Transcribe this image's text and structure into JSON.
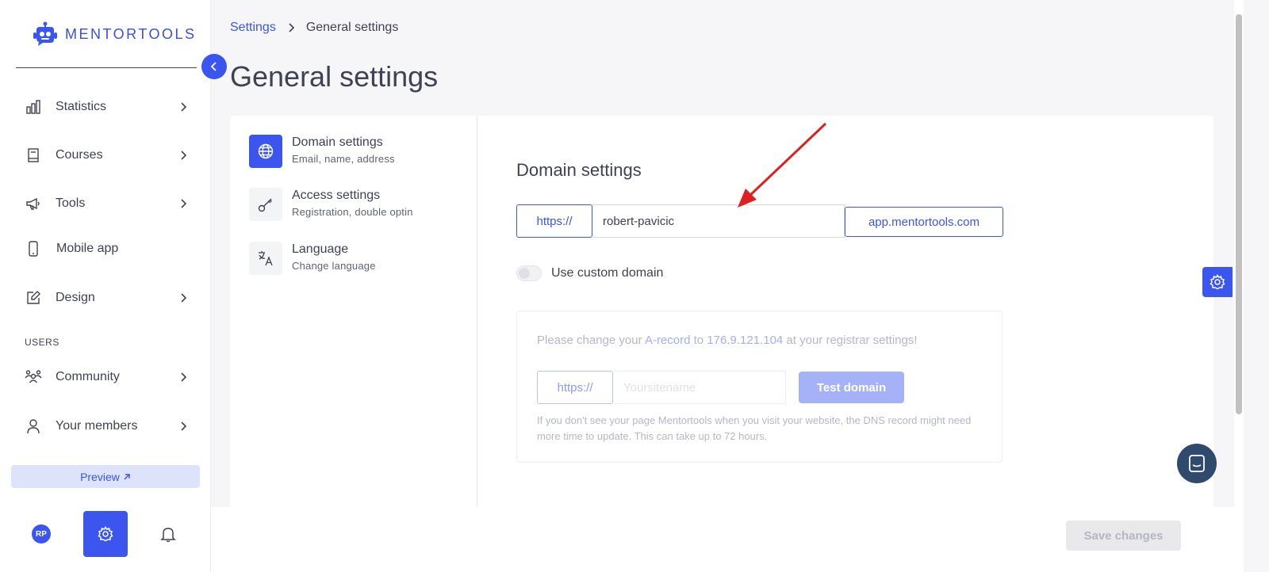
{
  "brand": {
    "name": "MENTORTOOLS",
    "accent": "#3b55ef"
  },
  "sidebar": {
    "items": [
      {
        "label": "Statistics",
        "icon": "bar-chart-icon"
      },
      {
        "label": "Courses",
        "icon": "book-icon"
      },
      {
        "label": "Tools",
        "icon": "megaphone-icon"
      },
      {
        "label": "Mobile app",
        "icon": "mobile-icon"
      },
      {
        "label": "Design",
        "icon": "pencil-icon"
      }
    ],
    "users_section_label": "USERS",
    "user_items": [
      {
        "label": "Community",
        "icon": "community-icon"
      },
      {
        "label": "Your members",
        "icon": "user-icon"
      }
    ],
    "preview_label": "Preview",
    "avatar_initials": "RP"
  },
  "breadcrumb": {
    "parent": "Settings",
    "current": "General settings"
  },
  "page_title": "General settings",
  "settings_menu": [
    {
      "title": "Domain settings",
      "subtitle": "Email, name, address"
    },
    {
      "title": "Access settings",
      "subtitle": "Registration, double optin"
    },
    {
      "title": "Language",
      "subtitle": "Change language"
    }
  ],
  "domain": {
    "section_title": "Domain settings",
    "prefix": "https://",
    "subdomain_value": "robert-pavicic",
    "suffix": "app.mentortools.com",
    "custom_toggle_label": "Use custom domain",
    "notice_pre": "Please change your ",
    "notice_record": "A-record",
    "notice_mid": " to ",
    "notice_ip": "176.9.121.104",
    "notice_post": " at your registrar settings!",
    "custom_prefix": "https://",
    "custom_placeholder": "Yoursitename",
    "test_button": "Test domain",
    "help_text": "If you don't see your page Mentortools when you visit your website, the DNS record might need more time to update. This can take up to 72 hours."
  },
  "save_button": "Save changes"
}
